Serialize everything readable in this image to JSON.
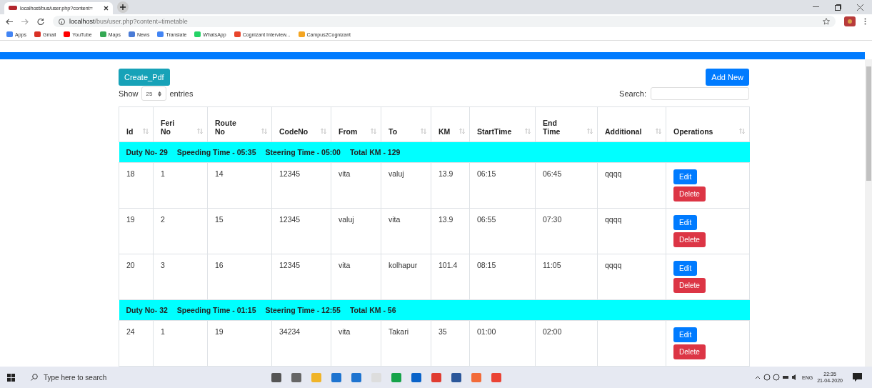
{
  "browser": {
    "tab_title": "localhost/bus/user.php?content=",
    "url_host": "localhost",
    "url_path": "/bus/user.php?content=timetable",
    "bookmarks": [
      {
        "label": "Apps",
        "color": "#4285f4"
      },
      {
        "label": "Gmail",
        "color": "#d93025"
      },
      {
        "label": "YouTube",
        "color": "#ff0000"
      },
      {
        "label": "Maps",
        "color": "#34a853"
      },
      {
        "label": "News",
        "color": "#4a7bd6"
      },
      {
        "label": "Translate",
        "color": "#4285f4"
      },
      {
        "label": "WhatsApp",
        "color": "#25d366"
      },
      {
        "label": "Cognizant Interview...",
        "color": "#e8452c"
      },
      {
        "label": "Campus2Cognizant",
        "color": "#f4a522"
      }
    ]
  },
  "toolbar": {
    "create_pdf": "Create_Pdf",
    "add_new": "Add New",
    "show_label": "Show",
    "show_value": "25",
    "entries_label": "entries",
    "search_label": "Search:"
  },
  "table": {
    "columns": [
      {
        "label": "Id"
      },
      {
        "label": "Feri No"
      },
      {
        "label": "Route No"
      },
      {
        "label": "CodeNo"
      },
      {
        "label": "From"
      },
      {
        "label": "To"
      },
      {
        "label": "KM"
      },
      {
        "label": "StartTime"
      },
      {
        "label": "End Time"
      },
      {
        "label": "Additional"
      },
      {
        "label": "Operations"
      }
    ],
    "groups": [
      {
        "summary": [
          "Duty No- 29",
          "Speeding Time - 05:35",
          "Steering Time - 05:00",
          "Total KM - 129"
        ],
        "rows": [
          {
            "cells": [
              "18",
              "1",
              "14",
              "12345",
              "vita",
              "valuj",
              "13.9",
              "06:15",
              "06:45",
              "qqqq"
            ],
            "actions": [
              "Edit",
              "Delete"
            ]
          },
          {
            "cells": [
              "19",
              "2",
              "15",
              "12345",
              "valuj",
              "vita",
              "13.9",
              "06:55",
              "07:30",
              "qqqq"
            ],
            "actions": [
              "Edit",
              "Delete"
            ]
          },
          {
            "cells": [
              "20",
              "3",
              "16",
              "12345",
              "vita",
              "kolhapur",
              "101.4",
              "08:15",
              "11:05",
              "qqqq"
            ],
            "actions": [
              "Edit",
              "Delete"
            ]
          }
        ]
      },
      {
        "summary": [
          "Duty No- 32",
          "Speeding Time - 01:15",
          "Steering Time - 12:55",
          "Total KM - 56"
        ],
        "rows": [
          {
            "cells": [
              "24",
              "1",
              "19",
              "34234",
              "vita",
              "Takari",
              "35",
              "01:00",
              "02:00",
              ""
            ],
            "actions": [
              "Edit",
              "Delete"
            ]
          }
        ]
      }
    ]
  },
  "taskbar": {
    "search_placeholder": "Type here to search",
    "language": "ENG",
    "time": "22:35",
    "date": "21-04-2020"
  }
}
